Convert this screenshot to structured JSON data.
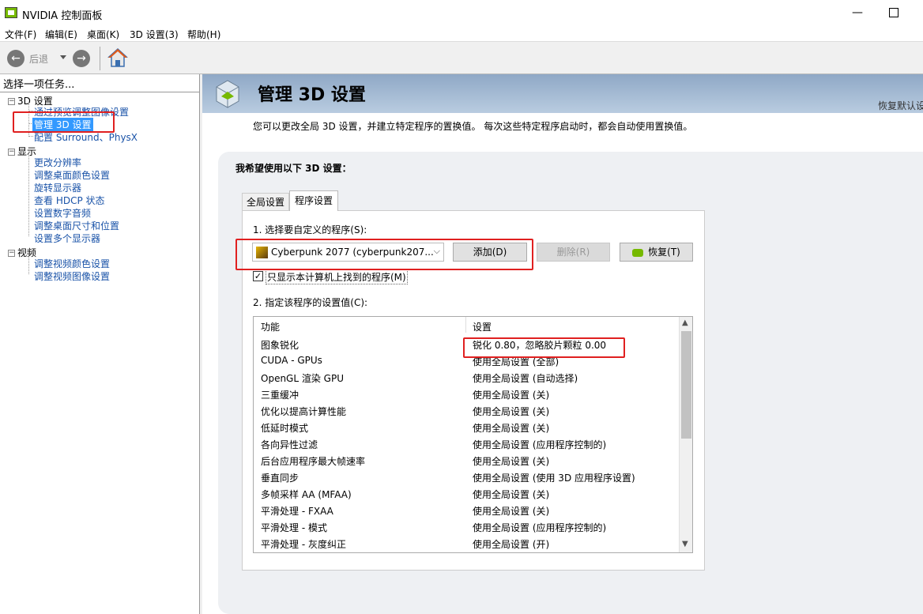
{
  "window": {
    "title": "NVIDIA 控制面板",
    "minimize": "—"
  },
  "menu": [
    "文件(F)",
    "编辑(E)",
    "桌面(K)",
    "3D 设置(3)",
    "帮助(H)"
  ],
  "toolbar": {
    "back_label": "后退",
    "back_glyph": "←",
    "forward_glyph": "→"
  },
  "left": {
    "task_label": "选择一项任务...",
    "groups": [
      {
        "label": "3D 设置",
        "expander": "−",
        "items": [
          "通过预览调整图像设置",
          "管理 3D 设置",
          "配置 Surround、PhysX"
        ]
      },
      {
        "label": "显示",
        "expander": "−",
        "items": [
          "更改分辨率",
          "调整桌面颜色设置",
          "旋转显示器",
          "查看 HDCP 状态",
          "设置数字音频",
          "调整桌面尺寸和位置",
          "设置多个显示器"
        ]
      },
      {
        "label": "视频",
        "expander": "−",
        "items": [
          "调整视频颜色设置",
          "调整视频图像设置"
        ]
      }
    ],
    "selected": "管理 3D 设置"
  },
  "main": {
    "title": "管理 3D 设置",
    "restore_defaults": "恢复默认设",
    "description": "您可以更改全局 3D 设置，并建立特定程序的置换值。 每次这些特定程序启动时，都会自动使用置换值。",
    "panel_heading": "我希望使用以下 3D 设置：",
    "tabs": [
      "全局设置",
      "程序设置"
    ],
    "active_tab": "程序设置",
    "select_program_label": "1. 选择要自定义的程序(S):",
    "program_value": "Cyberpunk 2077 (cyberpunk207...",
    "chevron": "⌵",
    "add_button": "添加(D)",
    "delete_button": "删除(R)",
    "restore_button": "恢复(T)",
    "only_found_checked": "✓",
    "only_found_label": "只显示本计算机上找到的程序(M)",
    "specify_label": "2. 指定该程序的设置值(C):",
    "grid_headers": [
      "功能",
      "设置"
    ],
    "grid_rows": [
      {
        "feature": "图象锐化",
        "setting": "锐化 0.80，忽略胶片颗粒 0.00"
      },
      {
        "feature": "CUDA - GPUs",
        "setting": "使用全局设置 (全部)"
      },
      {
        "feature": "OpenGL 渲染 GPU",
        "setting": "使用全局设置 (自动选择)"
      },
      {
        "feature": "三重缓冲",
        "setting": "使用全局设置 (关)"
      },
      {
        "feature": "优化以提高计算性能",
        "setting": "使用全局设置 (关)"
      },
      {
        "feature": "低延时模式",
        "setting": "使用全局设置 (关)"
      },
      {
        "feature": "各向异性过滤",
        "setting": "使用全局设置 (应用程序控制的)"
      },
      {
        "feature": "后台应用程序最大帧速率",
        "setting": "使用全局设置 (关)"
      },
      {
        "feature": "垂直同步",
        "setting": "使用全局设置 (使用 3D 应用程序设置)"
      },
      {
        "feature": "多帧采样 AA (MFAA)",
        "setting": "使用全局设置 (关)"
      },
      {
        "feature": "平滑处理 - FXAA",
        "setting": "使用全局设置 (关)"
      },
      {
        "feature": "平滑处理 - 模式",
        "setting": "使用全局设置 (应用程序控制的)"
      },
      {
        "feature": "平滑处理 - 灰度纠正",
        "setting": "使用全局设置 (开)"
      }
    ],
    "scroll_up": "▲",
    "scroll_down": "▼"
  },
  "colors": {
    "highlight_red": "#e02020",
    "selection_blue": "#3399ff",
    "nvidia_green": "#76b900"
  }
}
